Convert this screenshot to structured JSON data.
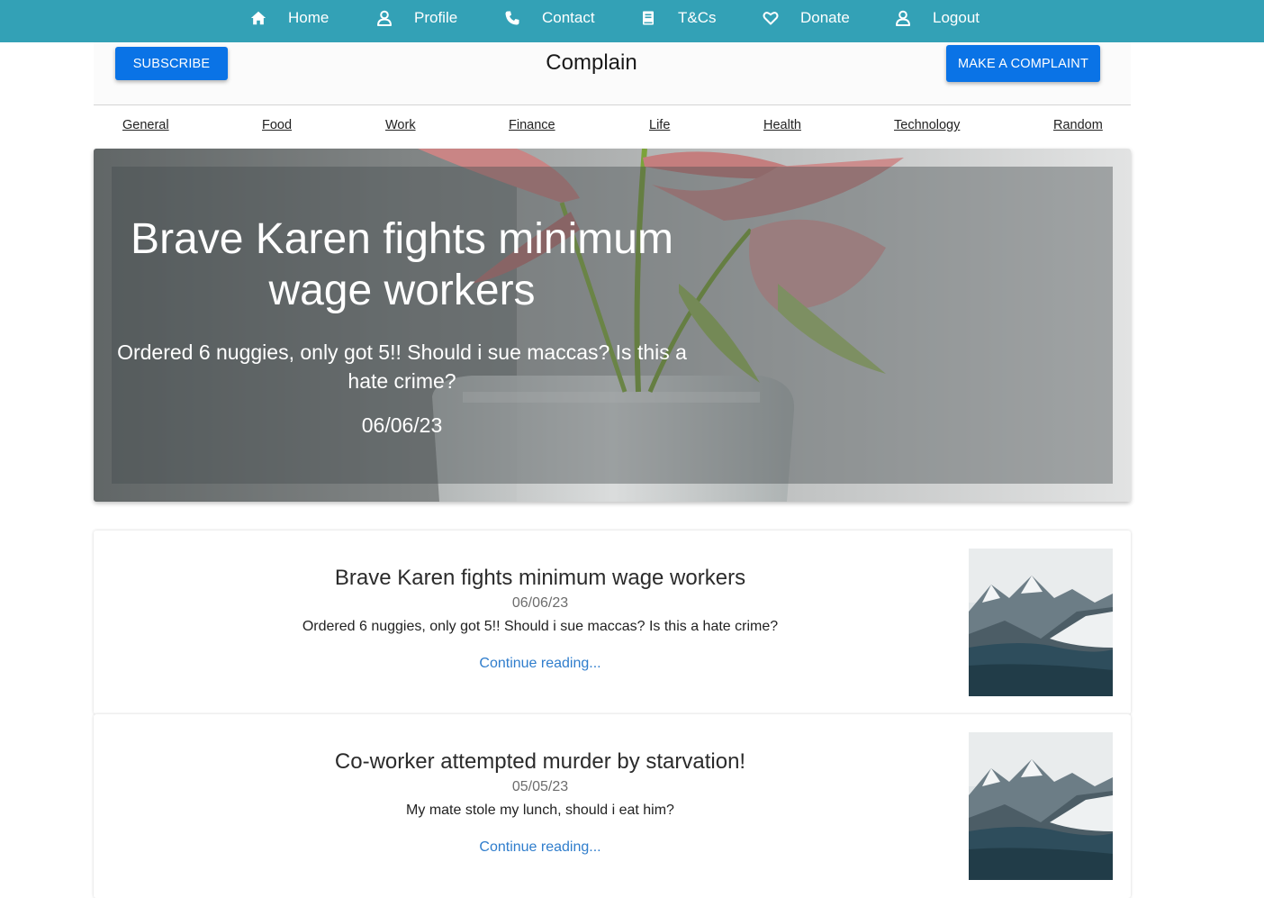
{
  "nav": {
    "items": [
      {
        "label": "Home",
        "icon": "home-icon"
      },
      {
        "label": "Profile",
        "icon": "user-icon"
      },
      {
        "label": "Contact",
        "icon": "phone-icon"
      },
      {
        "label": "T&Cs",
        "icon": "book-icon"
      },
      {
        "label": "Donate",
        "icon": "heart-icon"
      },
      {
        "label": "Logout",
        "icon": "user-icon"
      }
    ],
    "background": "#33a1b6"
  },
  "header": {
    "title": "Complain",
    "subscribe_label": "SUBSCRIBE",
    "complaint_label": "MAKE A COMPLAINT",
    "button_color": "#0a73e6"
  },
  "categories": [
    "General",
    "Food",
    "Work",
    "Finance",
    "Life",
    "Health",
    "Technology",
    "Random"
  ],
  "hero": {
    "title": "Brave Karen fights minimum wage workers",
    "subtitle": "Ordered 6 nuggies, only got 5!! Should i sue maccas? Is this a hate crime?",
    "date": "06/06/23"
  },
  "posts": [
    {
      "title": "Brave Karen fights minimum wage workers",
      "date": "06/06/23",
      "excerpt": "Ordered 6 nuggies, only got 5!! Should i sue maccas? Is this a hate crime?",
      "link": "Continue reading..."
    },
    {
      "title": "Co-worker attempted murder by starvation!",
      "date": "05/05/23",
      "excerpt": "My mate stole my lunch, should i eat him?",
      "link": "Continue reading..."
    }
  ]
}
